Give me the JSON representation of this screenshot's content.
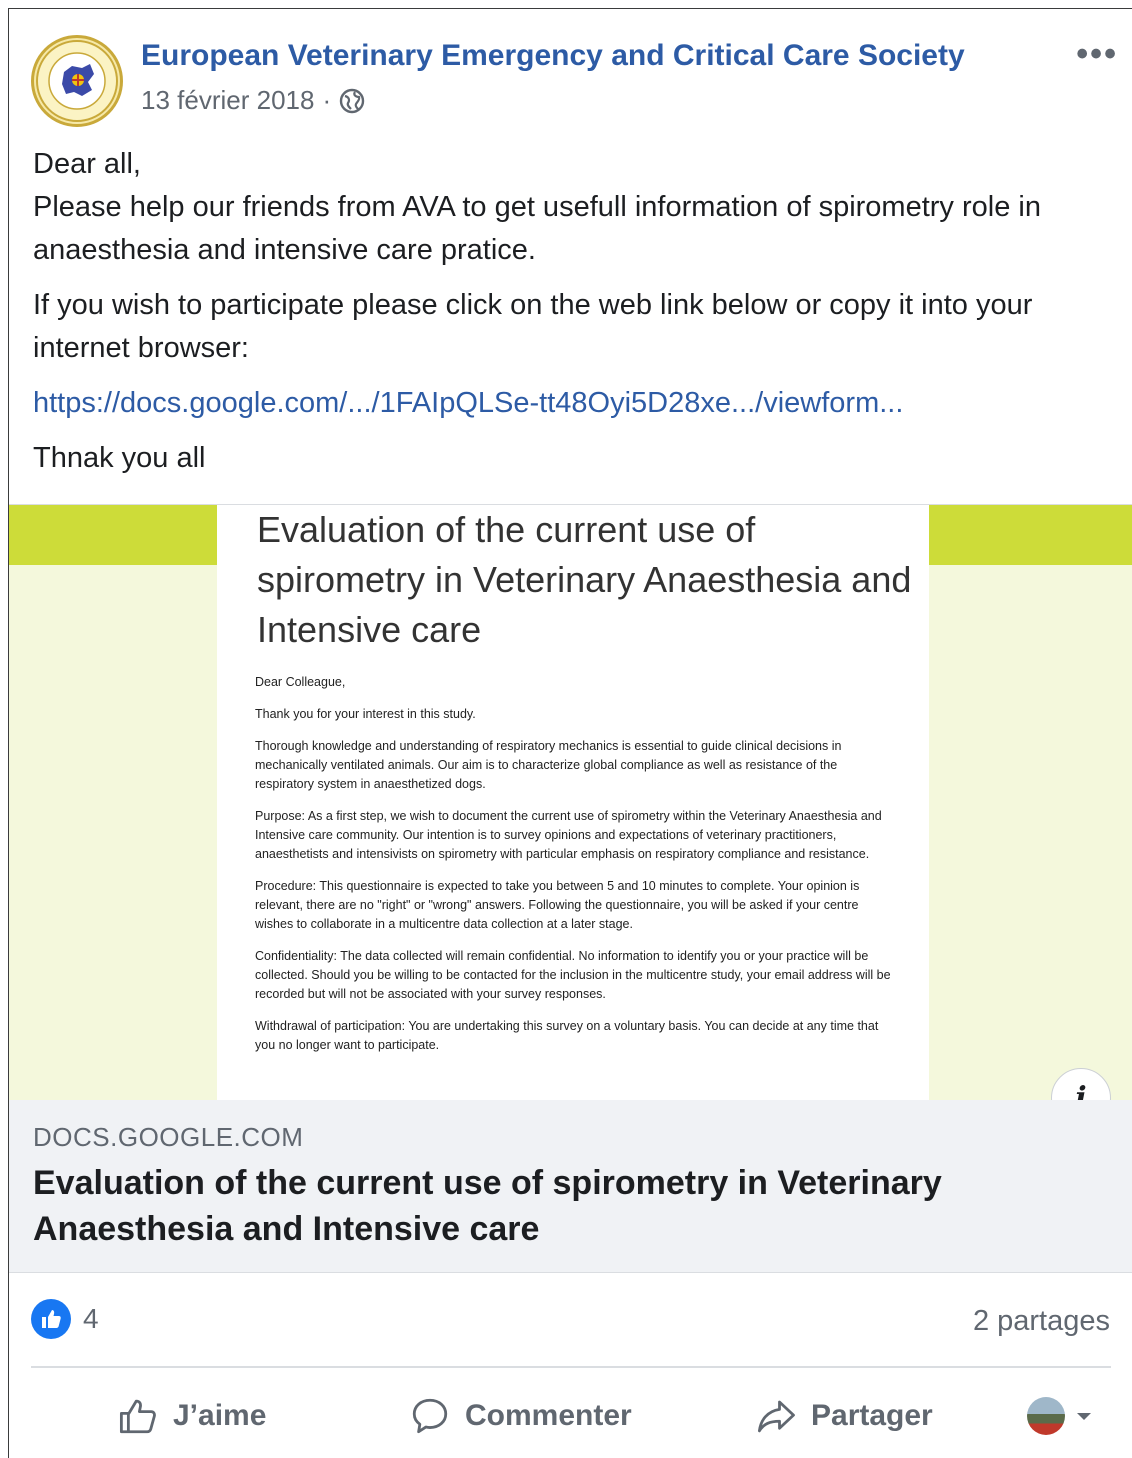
{
  "post": {
    "page_name": "European Veterinary Emergency and Critical Care Society",
    "date": "13 février 2018",
    "separator": "·",
    "privacy_icon": "globe-icon",
    "more_icon": "more-options-icon",
    "more_label": "•••"
  },
  "message": {
    "line1": "Dear all,",
    "line2": "Please help our friends from AVA to get usefull information of spirometry role in anaesthesia and intensive care pratice.",
    "line3": "If you wish to participate please click on the web link below or copy it into your internet browser:",
    "link": "https://docs.google.com/.../1FAIpQLSe-tt48Oyi5D28xe.../viewform...",
    "closing": "Thnak you all"
  },
  "preview": {
    "colors": {
      "accent_band": "#cddc39",
      "background": "#f4f8dc"
    },
    "form_title": "Evaluation of the current use of spirometry in Veterinary Anaesthesia and Intensive care",
    "form_paragraphs": [
      "Dear Colleague,",
      "Thank you for your interest in this study.",
      "Thorough knowledge and understanding of respiratory mechanics is essential to guide clinical decisions in mechanically ventilated animals. Our aim is to characterize global compliance as well as resistance of the respiratory system in anaesthetized dogs.",
      "Purpose: As a first step, we wish to document the current use of spirometry within the Veterinary Anaesthesia and Intensive care community. Our intention is to survey opinions and expectations of veterinary practitioners, anaesthetists and intensivists on spirometry with particular emphasis on respiratory compliance and resistance.",
      "Procedure: This questionnaire is expected to take you between 5 and 10 minutes to complete. Your opinion is relevant, there are no \"right\" or \"wrong\" answers. Following the questionnaire, you will be asked if your centre wishes to collaborate in a multicentre data collection at a later stage.",
      "Confidentiality: The data collected will remain confidential. No information to identify you or your practice will be collected. Should you be willing to be contacted for the inclusion in the multicentre study, your email address will be recorded but will not be associated with your survey responses.",
      "Withdrawal of participation: You are undertaking this survey on a voluntary basis. You can decide at any time that you no longer want to participate."
    ],
    "info_label": "i",
    "domain": "DOCS.GOOGLE.COM",
    "title": "Evaluation of the current use of spirometry in Veterinary Anaesthesia and Intensive care"
  },
  "stats": {
    "like_count": "4",
    "shares": "2 partages",
    "like_color": "#1877f2"
  },
  "actions": {
    "like": "J’aime",
    "comment": "Commenter",
    "share": "Partager"
  }
}
